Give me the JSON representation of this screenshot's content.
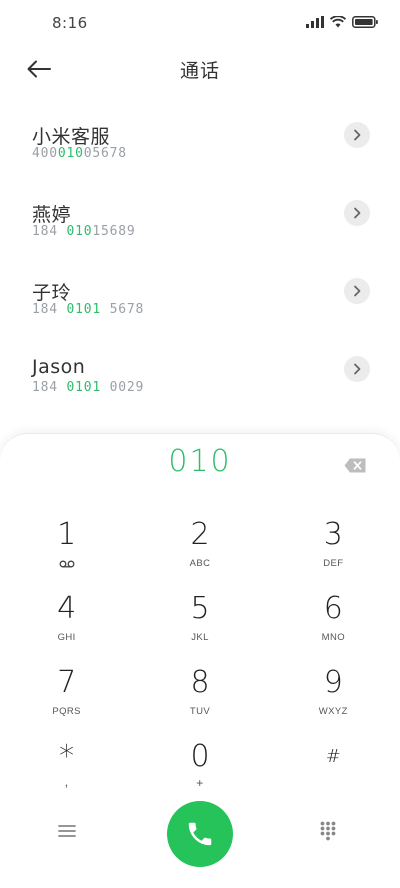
{
  "status_bar": {
    "time": "8:16"
  },
  "header": {
    "title": "通话"
  },
  "contacts": [
    {
      "name": "小米客服",
      "number_parts": [
        "400",
        "1005678"
      ],
      "number_match": "010",
      "number_before": "400",
      "number_after": "05678"
    },
    {
      "name": "燕婷",
      "number_before": "184 ",
      "number_match": "010",
      "number_after": "15689"
    },
    {
      "name": "子玲",
      "number_before": "184 ",
      "number_match": "0101",
      "number_after": " 5678"
    },
    {
      "name": "Jason",
      "number_before": "184 ",
      "number_match": "0101",
      "number_after": " 0029"
    }
  ],
  "dialer": {
    "dialed": "010",
    "keys": [
      [
        {
          "digit": "1",
          "letters": "voicemail-icon"
        },
        {
          "digit": "2",
          "letters": "ABC"
        },
        {
          "digit": "3",
          "letters": "DEF"
        }
      ],
      [
        {
          "digit": "4",
          "letters": "GHI"
        },
        {
          "digit": "5",
          "letters": "JKL"
        },
        {
          "digit": "6",
          "letters": "MNO"
        }
      ],
      [
        {
          "digit": "7",
          "letters": "PQRS"
        },
        {
          "digit": "8",
          "letters": "TUV"
        },
        {
          "digit": "9",
          "letters": "WXYZ"
        }
      ],
      [
        {
          "digit": "*",
          "letters": ","
        },
        {
          "digit": "0",
          "letters": "+"
        },
        {
          "digit": "#",
          "letters": ""
        }
      ]
    ]
  },
  "colors": {
    "accent": "#2ebd6b",
    "call_button": "#26c35a"
  }
}
